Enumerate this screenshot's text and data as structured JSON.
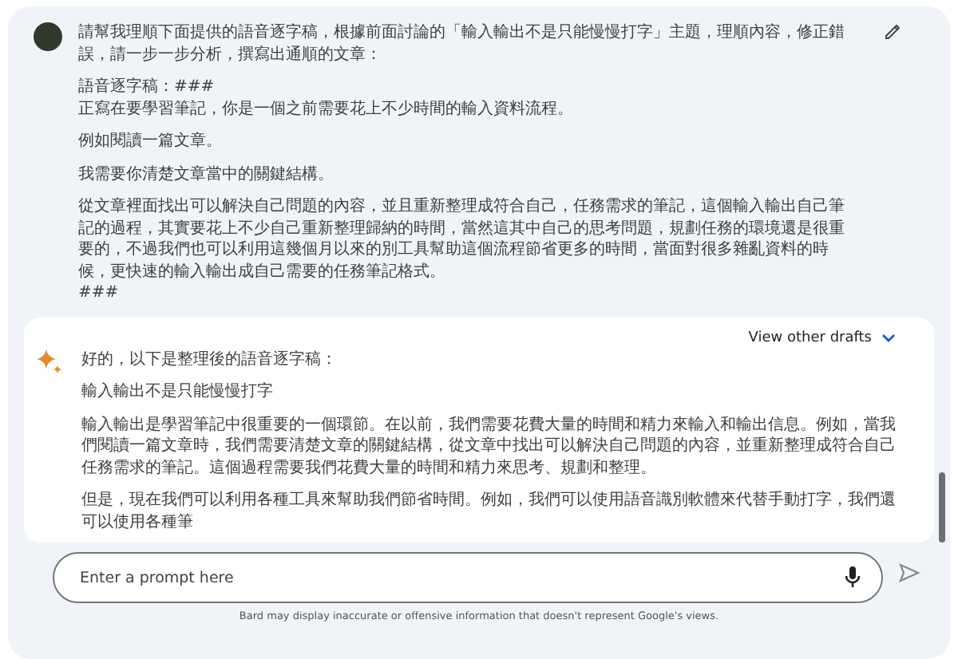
{
  "prompt": {
    "paragraphs": [
      {
        "lines": [
          "請幫我理順下面提供的語音逐字稿，根據前面討論的「輸入輸出不是只能慢慢打字」主題，理順內容，修正錯誤，請一步一步分析，撰寫出通順的文章："
        ]
      },
      {
        "lines": [
          "語音逐字稿：###",
          "正寫在要學習筆記，你是一個之前需要花上不少時間的輸入資料流程。"
        ]
      },
      {
        "lines": [
          "例如閱讀一篇文章。"
        ]
      },
      {
        "lines": [
          "我需要你清楚文章當中的關鍵結構。"
        ]
      },
      {
        "lines": [
          "從文章裡面找出可以解決自己問題的內容，並且重新整理成符合自己，任務需求的筆記，這個輸入輸出自己筆記的過程，其實要花上不少自己重新整理歸納的時間，當然這其中自己的思考問題，規劃任務的環境還是很重要的，不過我們也可以利用這幾個月以來的別工具幫助這個流程節省更多的時間，當面對很多雜亂資料的時候，更快速的輸入輸出成自己需要的任務筆記格式。",
          "###"
        ]
      }
    ]
  },
  "response": {
    "drafts_label": "View other drafts",
    "paragraphs": [
      "好的，以下是整理後的語音逐字稿：",
      "輸入輸出不是只能慢慢打字",
      "輸入輸出是學習筆記中很重要的一個環節。在以前，我們需要花費大量的時間和精力來輸入和輸出信息。例如，當我們閱讀一篇文章時，我們需要清楚文章的關鍵結構，從文章中找出可以解決自己問題的內容，並重新整理成符合自己任務需求的筆記。這個過程需要我們花費大量的時間和精力來思考、規劃和整理。",
      "但是，現在我們可以利用各種工具來幫助我們節省時間。例如，我們可以使用語音識別軟體來代替手動打字，我們還可以使用各種筆"
    ]
  },
  "input": {
    "placeholder": "Enter a prompt here"
  },
  "disclaimer": "Bard may display inaccurate or offensive information that doesn't represent Google's views."
}
